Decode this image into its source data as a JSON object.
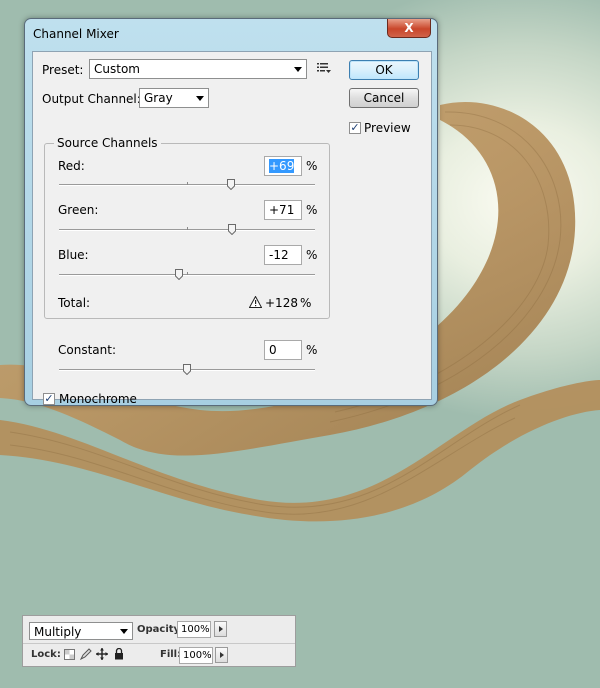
{
  "dialog": {
    "title": "Channel Mixer",
    "close_glyph": "X",
    "preset": {
      "label": "Preset:",
      "value": "Custom"
    },
    "output_channel": {
      "label": "Output Channel:",
      "value": "Gray"
    },
    "ok_label": "OK",
    "cancel_label": "Cancel",
    "preview": {
      "label": "Preview",
      "checked": true
    },
    "source_channels": {
      "title": "Source Channels",
      "channels": [
        {
          "label": "Red:",
          "value": "+69",
          "unit": "%",
          "level": 69
        },
        {
          "label": "Green:",
          "value": "+71",
          "unit": "%",
          "level": 71
        },
        {
          "label": "Blue:",
          "value": "-12",
          "unit": "%",
          "level": -12
        }
      ],
      "total": {
        "label": "Total:",
        "value": "+128",
        "unit": "%",
        "warning_icon": "warning-triangle-icon"
      }
    },
    "constant": {
      "label": "Constant:",
      "value": "0",
      "unit": "%",
      "level": 0
    },
    "monochrome": {
      "label": "Monochrome",
      "checked": true
    }
  },
  "layers_panel": {
    "blend_mode": "Multiply",
    "opacity_label": "Opacity:",
    "opacity_value": "100%",
    "lock_label": "Lock:",
    "fill_label": "Fill:",
    "fill_value": "100%",
    "lock_icons": [
      "lock-transparent-pixels-icon",
      "lock-image-pixels-icon",
      "lock-position-icon",
      "lock-all-icon"
    ]
  }
}
